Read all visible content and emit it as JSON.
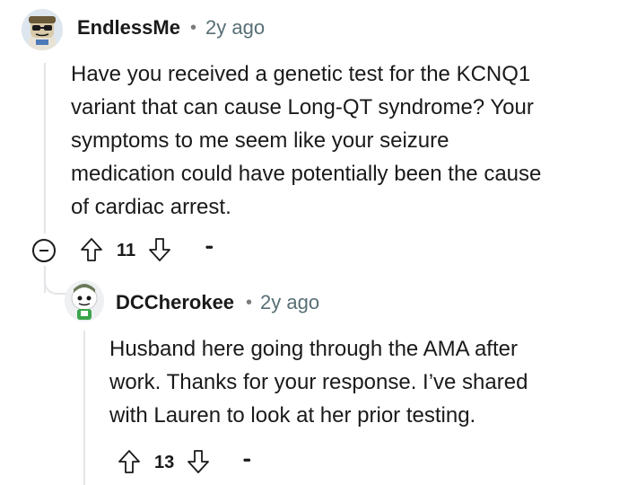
{
  "comments": [
    {
      "username": "EndlessMe",
      "separator": "•",
      "time": "2y ago",
      "body_lines": [
        "Have you received a genetic test for the KCNQ1",
        "variant that can cause Long-QT syndrome? Your",
        "symptoms to me seem like your seizure",
        "medication could have potentially been the cause",
        "of cardiac arrest."
      ],
      "score": "11",
      "more": "•••"
    },
    {
      "username": "DCCherokee",
      "separator": "•",
      "time": "2y ago",
      "body_lines": [
        "Husband here going through the AMA after",
        "work. Thanks for your response. I’ve shared",
        "with Lauren to look at her prior testing."
      ],
      "score": "13",
      "more": "•••"
    }
  ],
  "icons": {
    "upvote": "arrow-up-outline-icon",
    "downvote": "arrow-down-outline-icon",
    "collapse": "collapse-thread-icon",
    "more": "more-options-icon"
  },
  "colors": {
    "text": "#1a1a1b",
    "meta": "#576f76",
    "thread_line": "#e3e5e8"
  }
}
